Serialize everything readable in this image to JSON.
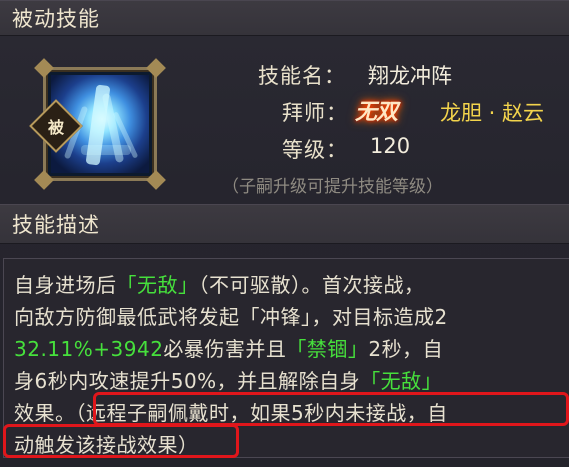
{
  "headers": {
    "passive_skill": "被动技能",
    "skill_description": "技能描述"
  },
  "icon": {
    "badge": "被",
    "name": "skill-dragon-charge-icon"
  },
  "info": {
    "skill_name_label": "技能名：",
    "skill_name": "翔龙冲阵",
    "master_label": "拜师：",
    "master_title": "无双",
    "master_name": "龙胆 · 赵云",
    "level_label": "等级：",
    "level": "120",
    "hint": "（子嗣升级可提升技能等级）"
  },
  "description": {
    "line1_a": "自身进场后",
    "line1_b": "「无敌」",
    "line1_c": "（不可驱散）。首次接战，",
    "line2": "向敌方防御最低武将发起「冲锋」，对目标造成2",
    "line3_a": "32.11%+3942",
    "line3_b": "必暴伤害并且",
    "line3_c": "「禁锢」",
    "line3_d": "2秒，自",
    "line4_a": "身6秒内攻速提升50%，并且解除自身",
    "line4_b": "「无敌」",
    "line5_a": "效果。",
    "line5_b": "（远程子嗣佩戴时，如果5秒内未接战，自",
    "line6": "动触发该接战效果）"
  },
  "colors": {
    "highlight_green": "#46e03c",
    "master_gold": "#f3d44c",
    "outline_red": "#e0161b"
  }
}
